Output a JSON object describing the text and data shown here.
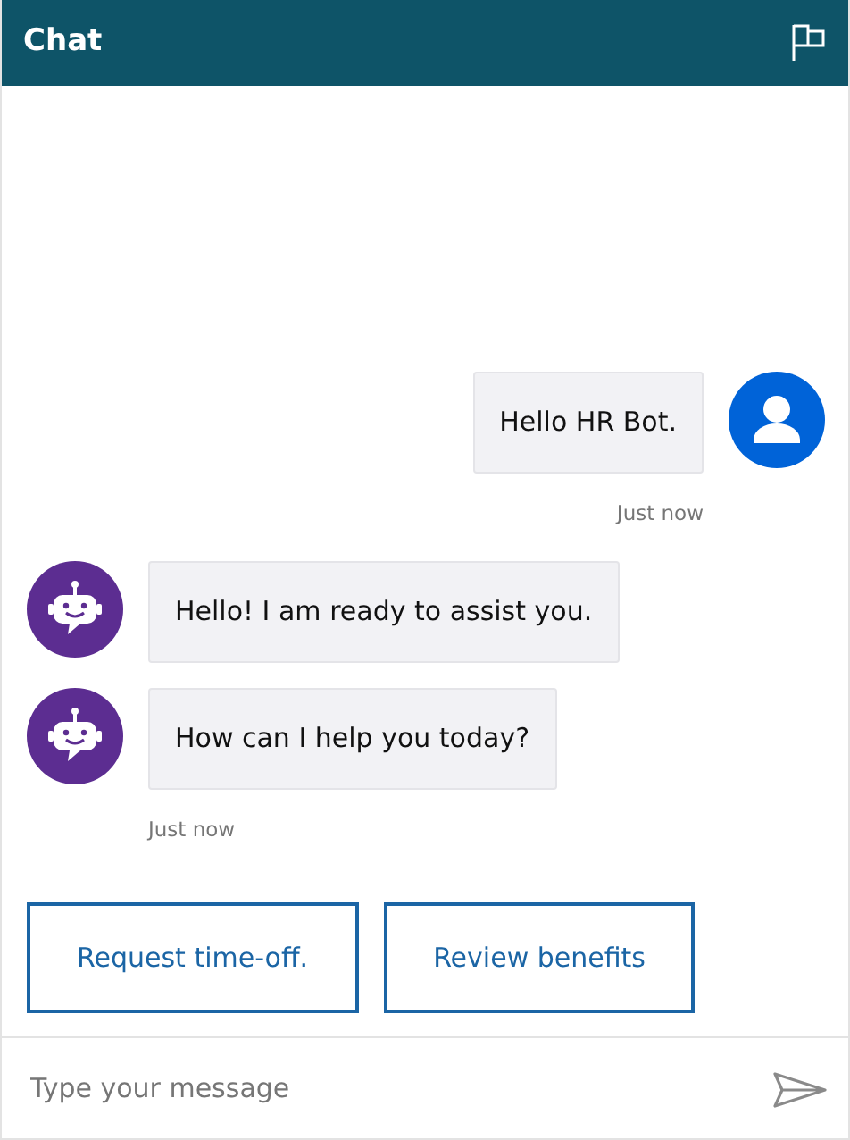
{
  "header": {
    "title": "Chat"
  },
  "groups": [
    {
      "kind": "user",
      "messages": [
        "Hello HR Bot."
      ],
      "time": "Just now"
    },
    {
      "kind": "bot",
      "messages": [
        "Hello! I am ready to assist you.",
        "How can I help you today?"
      ],
      "time": "Just now"
    }
  ],
  "suggestions": [
    "Request time-off.",
    "Review benefits"
  ],
  "composer": {
    "placeholder": "Type your message"
  }
}
